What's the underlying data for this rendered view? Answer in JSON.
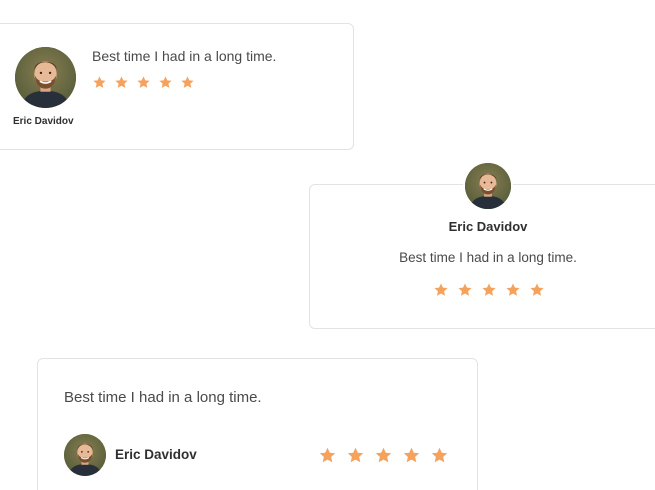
{
  "colors": {
    "star": "#F5A25D",
    "border": "#E3E3E3",
    "text": "#4A4A4A",
    "name": "#2F2F2F"
  },
  "testimonials": [
    {
      "quote": "Best time I had in a long time.",
      "name": "Eric Davidov",
      "rating": 5,
      "avatar_icon": "person-photo"
    },
    {
      "quote": "Best time I had in a long time.",
      "name": "Eric Davidov",
      "rating": 5,
      "avatar_icon": "person-photo"
    },
    {
      "quote": "Best time I had in a long time.",
      "name": "Eric Davidov",
      "rating": 5,
      "avatar_icon": "person-photo"
    }
  ]
}
